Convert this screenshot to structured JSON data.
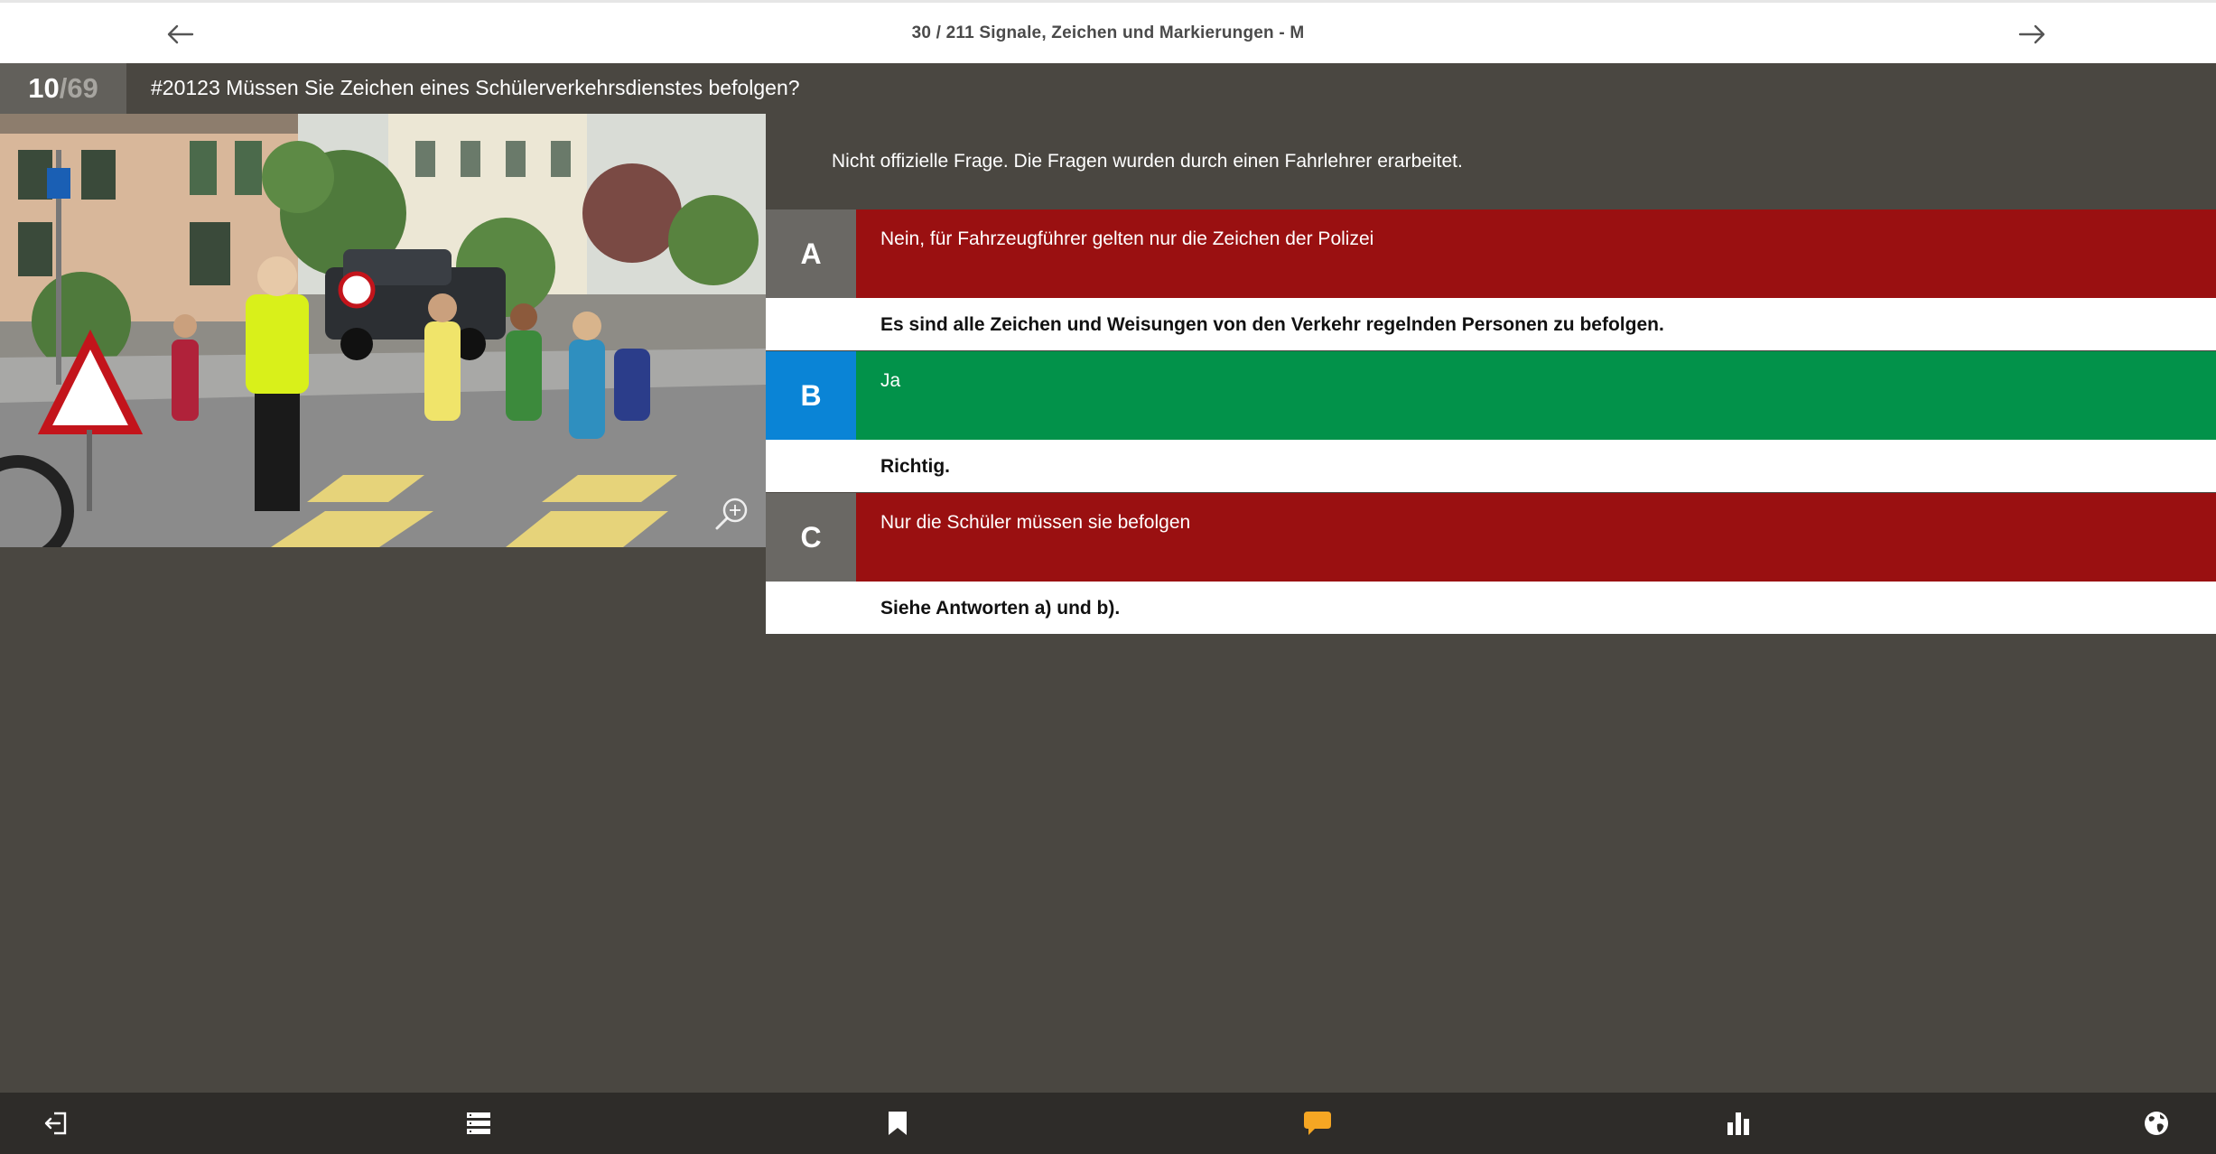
{
  "header": {
    "breadcrumb": "30 / 211 Signale, Zeichen und Markierungen - M",
    "prev_icon": "arrow-left-icon",
    "next_icon": "arrow-right-icon"
  },
  "question": {
    "current": "10",
    "separator": "/",
    "total": "69",
    "title": "#20123 Müssen Sie Zeichen eines Schülerverkehrsdienstes befolgen?"
  },
  "notice": "Nicht offizielle Frage. Die Fragen wurden durch einen Fahrlehrer erarbeitet.",
  "answers": [
    {
      "letter": "A",
      "text": "Nein, für Fahrzeugführer gelten nur die Zeichen der Polizei",
      "explanation": "Es sind alle Zeichen und Weisungen von den Verkehr regelnden Personen zu befolgen.",
      "status": "wrong"
    },
    {
      "letter": "B",
      "text": "Ja",
      "explanation": "Richtig.",
      "status": "correct"
    },
    {
      "letter": "C",
      "text": "Nur die Schüler müssen sie befolgen",
      "explanation": "Siehe Antworten a) und b).",
      "status": "wrong"
    }
  ],
  "colors": {
    "background": "#4a4741",
    "wrong": "#9a1011",
    "correct": "#02924a",
    "correct_letter": "#0a84d6",
    "neutral_letter": "#6a6864",
    "chat_icon": "#f5a623"
  },
  "toolbar": [
    {
      "icon": "exit-icon"
    },
    {
      "icon": "list-icon"
    },
    {
      "icon": "bookmark-icon"
    },
    {
      "icon": "chat-bubble-icon"
    },
    {
      "icon": "bar-chart-icon"
    },
    {
      "icon": "globe-icon"
    }
  ]
}
